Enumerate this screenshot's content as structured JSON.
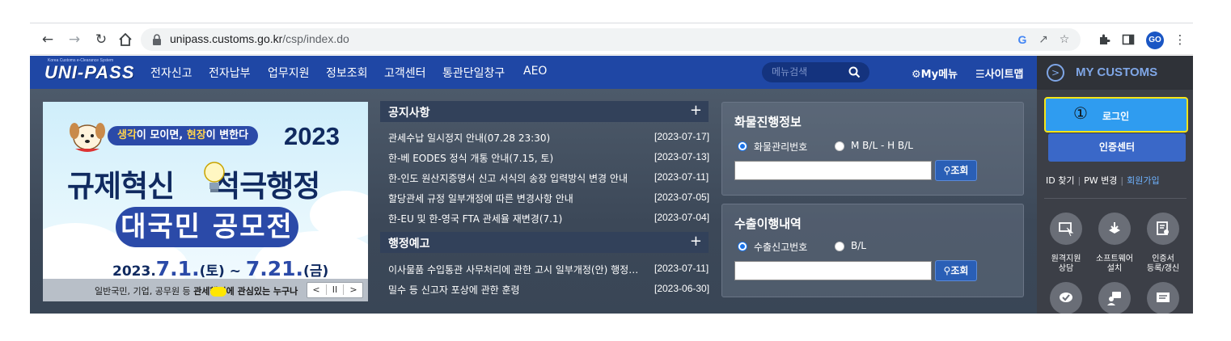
{
  "browser": {
    "url_host": "unipass.customs.go.kr",
    "url_path": "/csp/index.do",
    "profile_initials": "GO"
  },
  "site": {
    "logo_small": "Korea Customs e-Clearance System",
    "logo_text": "UNI-PASS",
    "nav": [
      "전자신고",
      "전자납부",
      "업무지원",
      "정보조회",
      "고객센터",
      "통관단일창구",
      "AEO"
    ],
    "search_placeholder": "메뉴검색",
    "my_menu": "My메뉴",
    "sitemap": "사이트맵"
  },
  "banner": {
    "tagline_part1": "생각",
    "tagline_part2": "이 모이면, ",
    "tagline_part3": "현장",
    "tagline_part4": "이 변한다",
    "year": "2023",
    "headline_left": "규제혁신",
    "headline_right": "적극행정",
    "pill": "대국민 공모전",
    "date_prefix": "2023.",
    "date_start": "7.1.",
    "date_start_day": "(토)",
    "date_sep": "~",
    "date_end": "7.21.",
    "date_end_day": "(금)",
    "bottom_text_plain": "일반국민, 기업, 공무원 등 ",
    "bottom_text_bold": "관세행정에 관심있는 누구나",
    "ctrl_prev": "<",
    "ctrl_pause": "II",
    "ctrl_next": ">"
  },
  "notices": {
    "title": "공지사항",
    "plus": "+",
    "items": [
      {
        "title": "관세수납 일시정지 안내(07.28 23:30)",
        "date": "[2023-07-17]"
      },
      {
        "title": "한-베 EODES 정식 개통 안내(7.15, 토)",
        "date": "[2023-07-13]"
      },
      {
        "title": "한-인도 원산지증명서 신고 서식의 송장 입력방식 변경 안내",
        "date": "[2023-07-11]"
      },
      {
        "title": "할당관세 규정 일부개정에 따른 변경사항 안내",
        "date": "[2023-07-05]"
      },
      {
        "title": "한-EU 및 한-영국 FTA 관세율 재변경(7.1)",
        "date": "[2023-07-04]"
      }
    ]
  },
  "admin_notices": {
    "title": "행정예고",
    "plus": "+",
    "items": [
      {
        "title": "이사물품 수입통관 사무처리에 관한 고시 일부개정(안) 행정예고",
        "date": "[2023-07-11]"
      },
      {
        "title": "밀수 등 신고자 포상에 관한 훈령",
        "date": "[2023-06-30]"
      }
    ]
  },
  "cargo": {
    "title": "화물진행정보",
    "option1": "화물관리번호",
    "option2": "M B/L - H B/L",
    "button": "조회"
  },
  "export": {
    "title": "수출이행내역",
    "option1": "수출신고번호",
    "option2": "B/L",
    "button": "조회"
  },
  "my_customs": {
    "title": "MY CUSTOMS",
    "circle_arrow": ">",
    "login_marker": "①",
    "login": "로그인",
    "cert_center": "인증센터",
    "find_id": "ID 찾기",
    "pw_change": "PW 변경",
    "join": "회원가입",
    "sep": "|",
    "quick": [
      {
        "line1": "원격지원",
        "line2": "상담"
      },
      {
        "line1": "소프트웨어",
        "line2": "설치"
      },
      {
        "line1": "인증서",
        "line2": "등록/갱신"
      }
    ]
  },
  "colors": {
    "header_blue": "#1f47a5",
    "login_blue": "#2f9cf0",
    "highlight_yellow": "#f6e518",
    "cert_blue": "#3a68c8"
  }
}
